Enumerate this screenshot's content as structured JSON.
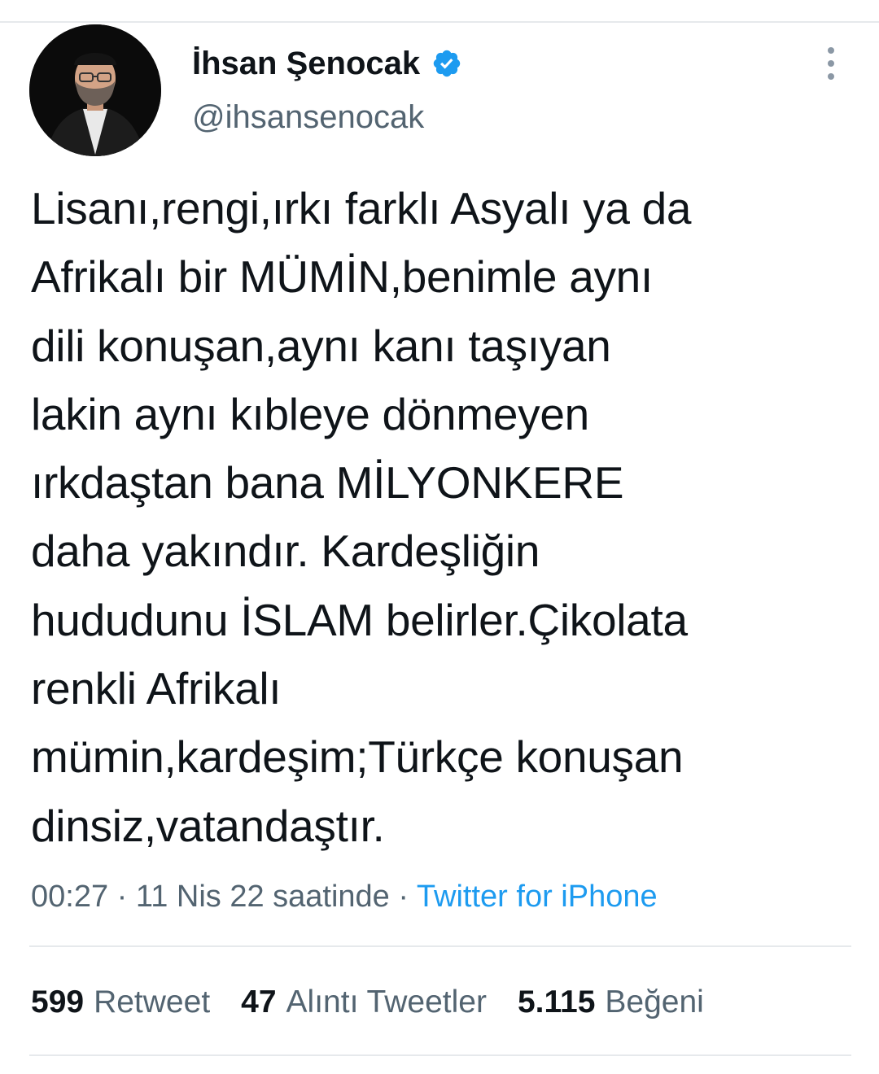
{
  "tweet": {
    "author": {
      "display_name": "İhsan Şenocak",
      "handle": "@ihsansenocak",
      "verified": true
    },
    "text": "Lisanı,rengi,ırkı farklı Asyalı ya da\nAfrikalı bir MÜMİN,benimle aynı\ndili konuşan,aynı kanı taşıyan\nlakin aynı kıbleye dönmeyen\nırkdaştan bana MİLYONKERE\ndaha yakındır. Kardeşliğin\nhududunu İSLAM belirler.Çikolata\nrenkli Afrikalı\nmümin,kardeşim;Türkçe konuşan\ndinsiz,vatandaştır.",
    "meta": {
      "time": "00:27",
      "separator": "·",
      "date": "11 Nis 22 saatinde",
      "source": "Twitter for iPhone"
    },
    "stats": [
      {
        "count": "599",
        "label": "Retweet"
      },
      {
        "count": "47",
        "label": "Alıntı Tweetler"
      },
      {
        "count": "5.115",
        "label": "Beğeni"
      }
    ]
  },
  "colors": {
    "text_primary": "#0f1419",
    "text_secondary": "#536471",
    "accent": "#1d9bf0",
    "divider": "#e6e9ec"
  },
  "icons": {
    "verified": "verified-badge-icon",
    "more": "more-vertical-icon"
  }
}
